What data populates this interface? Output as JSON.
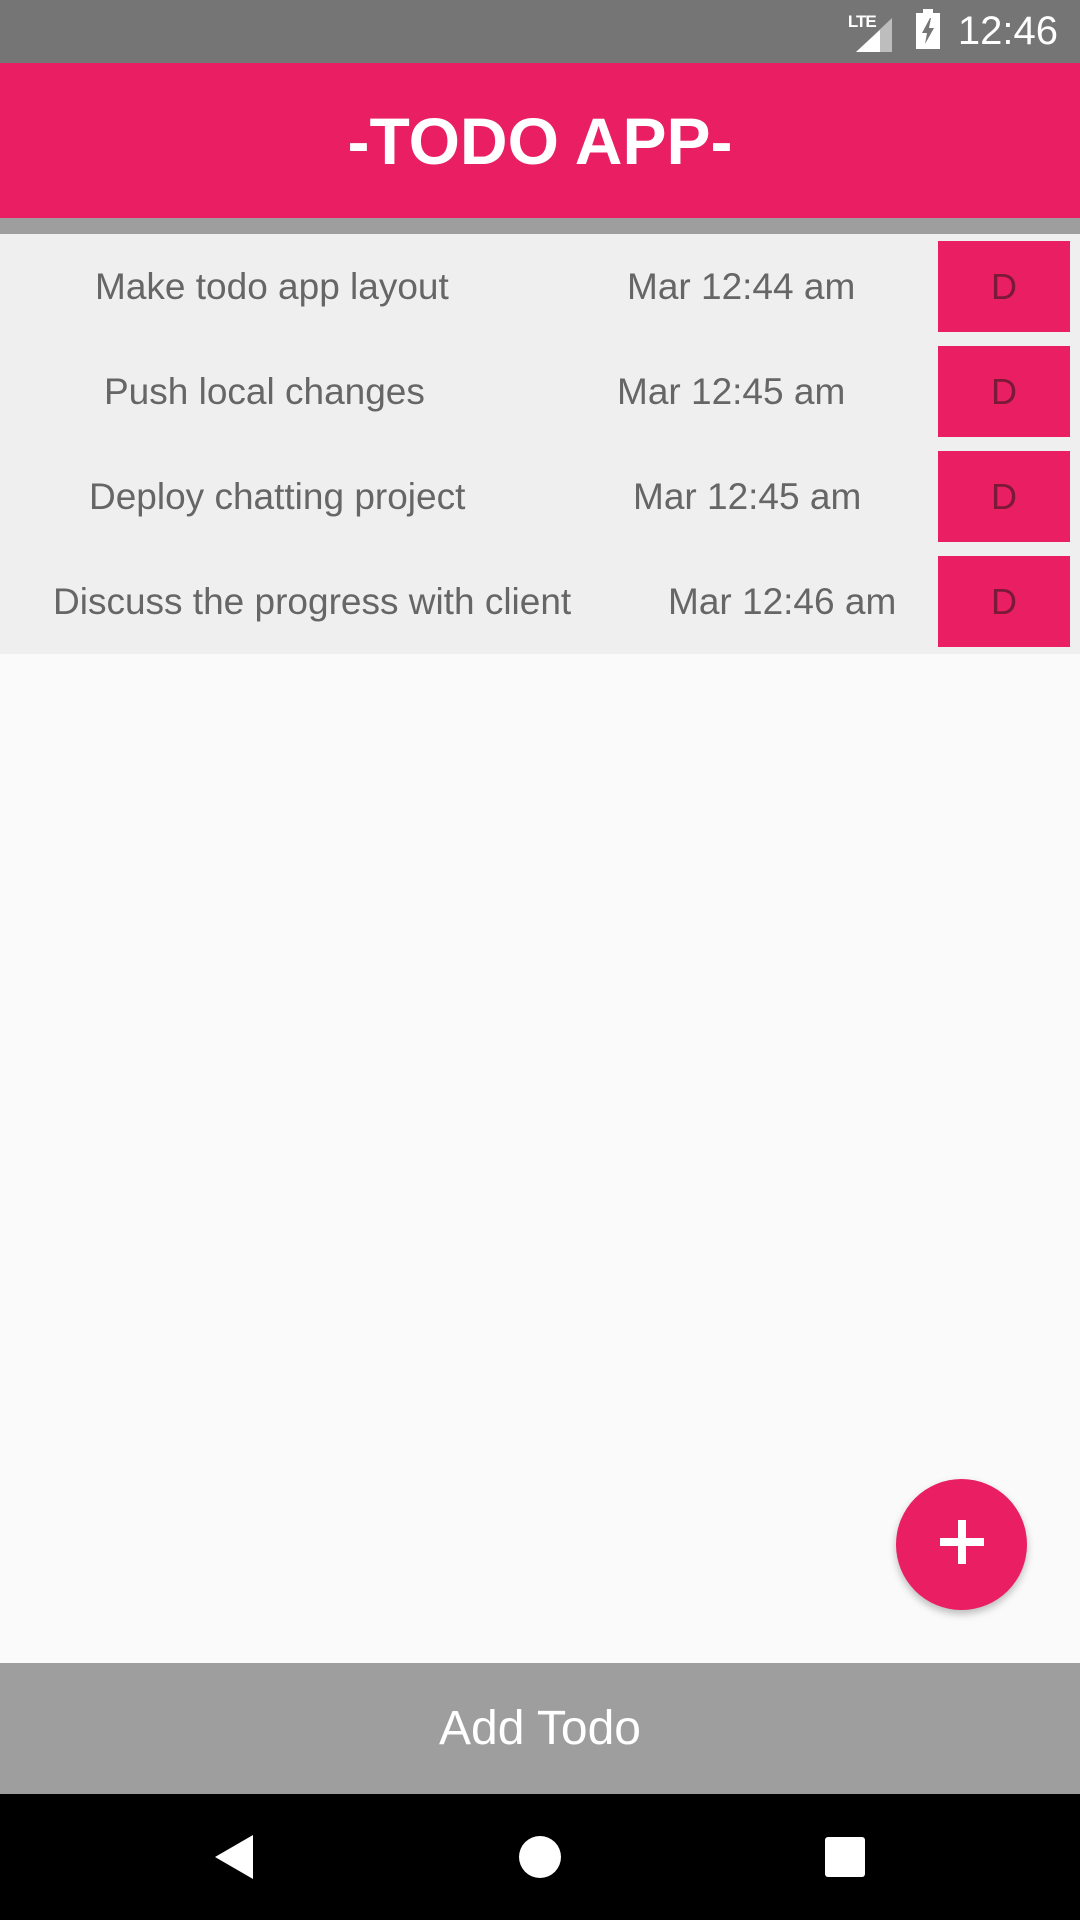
{
  "status_bar": {
    "network_label": "LTE",
    "time": "12:46",
    "icons": [
      "lte-signal-icon",
      "battery-charging-icon"
    ]
  },
  "app_bar": {
    "title": "-TODO APP-"
  },
  "todos": [
    {
      "title": "Make todo app layout",
      "time": "Mar 12:44 am",
      "delete_label": "D"
    },
    {
      "title": "Push local changes",
      "time": "Mar 12:45 am",
      "delete_label": "D"
    },
    {
      "title": "Deploy chatting project",
      "time": "Mar 12:45 am",
      "delete_label": "D"
    },
    {
      "title": "Discuss the progress with client",
      "time": "Mar 12:46 am",
      "delete_label": "D"
    }
  ],
  "fab": {
    "icon": "plus-icon"
  },
  "add_todo": {
    "label": "Add Todo"
  },
  "nav_bar": {
    "icons": [
      "back-icon",
      "home-icon",
      "recents-icon"
    ]
  },
  "colors": {
    "accent": "#e91e63",
    "status_bar": "#757575",
    "list_background": "#efefef",
    "add_bar": "#9e9e9e"
  }
}
